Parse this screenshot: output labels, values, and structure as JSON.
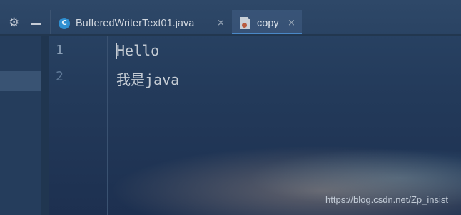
{
  "toolbar": {
    "settings_icon": "gear-icon",
    "hide_icon": "minus-icon"
  },
  "tabs": [
    {
      "label": "BufferedWriterText01.java",
      "icon": "java-class-icon",
      "icon_glyph": "C",
      "close": "×",
      "active": false
    },
    {
      "label": "copy",
      "icon": "text-file-icon",
      "close": "×",
      "active": true
    }
  ],
  "editor": {
    "lines": [
      {
        "number": "1",
        "text": "Hello"
      },
      {
        "number": "2",
        "text": "我是java"
      }
    ],
    "caret_line": 1
  },
  "watermark": "https://blog.csdn.net/Zp_insist",
  "colors": {
    "accent": "#4a88c7",
    "java_icon": "#2f8fd0",
    "text": "#c5ccd4"
  }
}
